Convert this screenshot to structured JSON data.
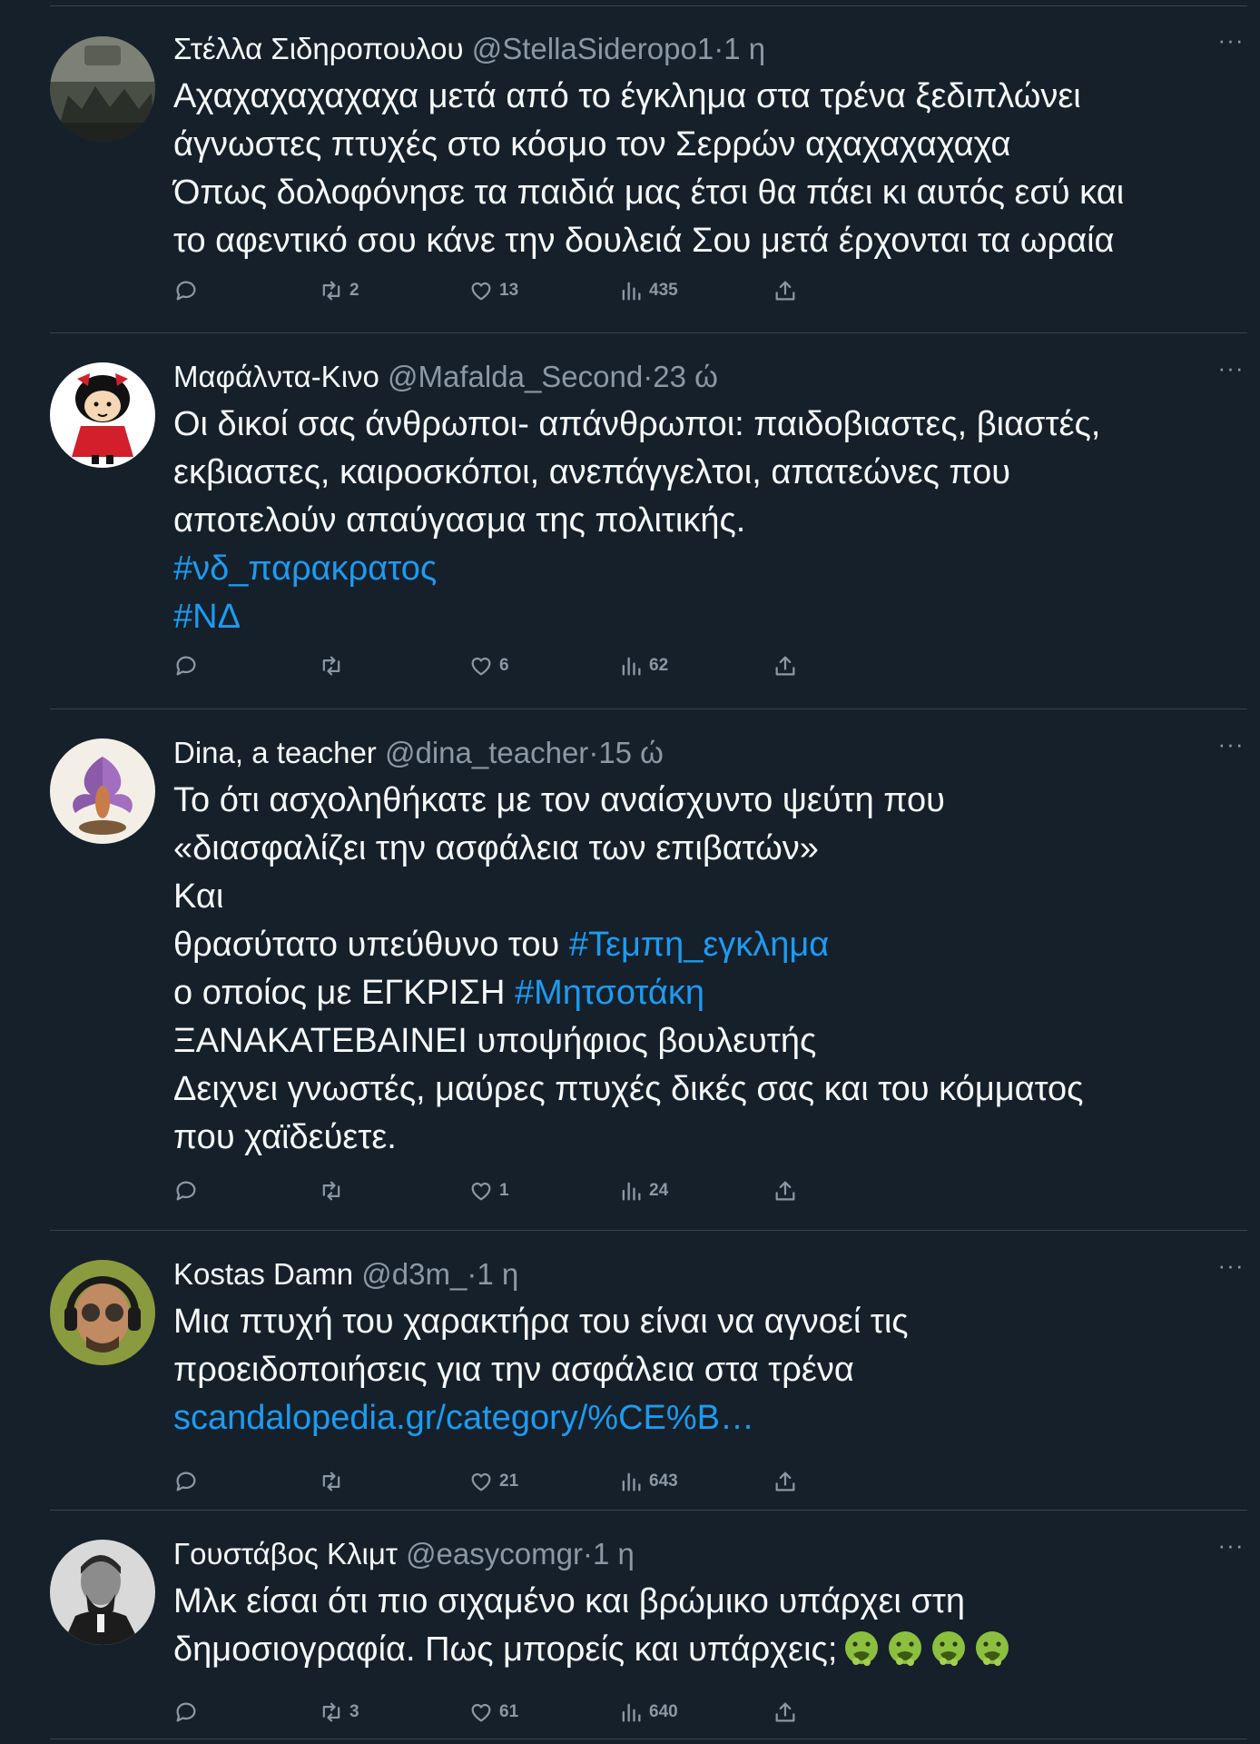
{
  "tweets": [
    {
      "name": "Στέλλα Σιδηροπουλου",
      "handle": "@StellaSideropo1",
      "time": "1 η",
      "lines": [
        "Αχαχαχαχαχαχα μετά από το έγκλημα στα τρένα ξεδιπλώνει",
        "άγνωστες πτυχές στο κόσμο τον Σερρών αχαχαχαχαχα",
        "Όπως δολοφόνησε τα παιδιά μας έτσι θα πάει κι αυτός εσύ και",
        "το αφεντικό σου κάνε την δουλειά Σου μετά έρχονται τα ωραία"
      ],
      "retweets": "2",
      "likes": "13",
      "views": "435"
    },
    {
      "name": "Μαφάλντα-Κινο",
      "handle": "@Mafalda_Second",
      "time": "23 ώ",
      "lines": [
        "Οι δικοί σας άνθρωποι- απάνθρωποι: παιδοβιαστες, βιαστές,",
        "εκβιαστες, καιροσκόποι, ανεπάγγελτοι, απατεώνες που",
        "αποτελούν απαύγασμα της πολιτικής."
      ],
      "hashtags": [
        "#νδ_παρακρατος",
        "#ΝΔ"
      ],
      "retweets": "",
      "likes": "6",
      "views": "62"
    },
    {
      "name": "Dina, a teacher",
      "handle": "@dina_teacher",
      "time": "15 ώ",
      "lines": [
        "Το ότι ασχοληθήκατε με τον αναίσχυντο ψεύτη που",
        "«διασφαλίζει την ασφάλεια των επιβατών»",
        "Και"
      ],
      "line4_text": "θρασύτατο υπεύθυνο του",
      "line4_tag": "#Τεμπη_εγκλημα",
      "line5_text": "ο οποίος με ΕΓΚΡΙΣΗ",
      "line5_tag": "#Μητσοτάκη",
      "lines_after": [
        "ΞΑΝΑΚΑΤΕΒΑΙΝΕΙ υποψήφιος βουλευτής",
        "Δειχνει γνωστές, μαύρες πτυχές δικές σας και του κόμματος",
        "που χαϊδεύετε."
      ],
      "retweets": "",
      "likes": "1",
      "views": "24"
    },
    {
      "name": "Kostas Damn",
      "handle": "@d3m_",
      "time": "1 η",
      "lines": [
        "Μια πτυχή του χαρακτήρα του είναι να αγνοεί τις",
        "προειδοποιήσεις για την ασφάλεια στα τρένα"
      ],
      "link": "scandalopedia.gr/category/%CE%B…",
      "retweets": "",
      "likes": "21",
      "views": "643"
    },
    {
      "name": "Γουστάβος Κλιμτ",
      "handle": "@easycomgr",
      "time": "1 η",
      "lines": [
        "Μλκ είσαι ότι πιο σιχαμένο και βρώμικο υπάρχει στη"
      ],
      "last_line": "δημοσιογραφία. Πως μπορείς και υπάρχεις;",
      "emojis": [
        "nauseated-face",
        "nauseated-face",
        "nauseated-face",
        "nauseated-face"
      ],
      "retweets": "3",
      "likes": "61",
      "views": "640"
    }
  ],
  "separator": "·",
  "more_glyph": "···",
  "colors": {
    "background": "#15202b",
    "text": "#f7f9f9",
    "secondary": "#8b98a5",
    "link": "#1d9bf0",
    "divider": "#38444d"
  }
}
